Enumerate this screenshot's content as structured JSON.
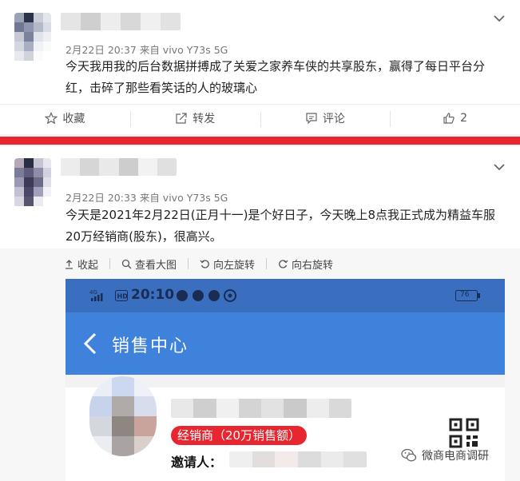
{
  "posts": [
    {
      "meta": "2月22日 20:37 来自 vivo Y73s 5G",
      "content": "今天我用我的后台数据拼搏成了关爱之家养车侠的共享股东，赢得了每日平台分红，击碎了那些看笑话的人的玻璃心",
      "actions": [
        {
          "label": "收藏",
          "icon": "star-icon"
        },
        {
          "label": "转发",
          "icon": "share-icon"
        },
        {
          "label": "评论",
          "icon": "comment-icon"
        },
        {
          "label": "2",
          "icon": "thumbs-up-icon"
        }
      ]
    },
    {
      "meta": "2月22日 20:33 来自 vivo Y73s 5G",
      "content": "今天是2021年2月22日(正月十一)是个好日子，今天晚上8点我正式成为精益车服20万经销商(股东)，很高兴。",
      "image_toolbar": [
        {
          "label": "收起",
          "icon": "collapse-icon"
        },
        {
          "label": "查看大图",
          "icon": "zoom-icon"
        },
        {
          "label": "向左旋转",
          "icon": "rotate-left-icon"
        },
        {
          "label": "向右旋转",
          "icon": "rotate-right-icon"
        }
      ],
      "screenshot": {
        "status_time": "20:10",
        "battery": "76",
        "app_title": "销售中心",
        "badge": "经销商（20万销售额）",
        "invite_label": "邀请人："
      }
    }
  ],
  "watermark": "微商电商调研",
  "colors": {
    "accent_red": "#e8262f",
    "app_blue": "#3f82dc",
    "status_blue": "#3a6fc0"
  }
}
